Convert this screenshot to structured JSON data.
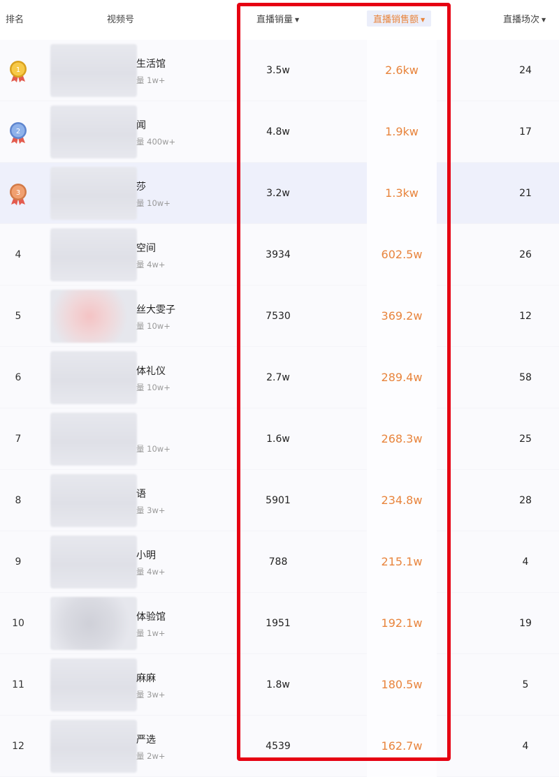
{
  "header": {
    "rank": "排名",
    "channel": "视频号",
    "live_sales": "直播销量",
    "live_gmv": "直播销售额",
    "live_sessions": "直播场次"
  },
  "accent_color": "#e8843c",
  "highlight_color": "#e60012",
  "rows": [
    {
      "rank": "1",
      "medal": "gold",
      "medal_num": "1",
      "name": "生活馆",
      "sub": "量 1w+",
      "sales": "3.5w",
      "gmv": "2.6kw",
      "sessions": "24"
    },
    {
      "rank": "2",
      "medal": "silver",
      "medal_num": "2",
      "name": "闻",
      "sub": "量 400w+",
      "sales": "4.8w",
      "gmv": "1.9kw",
      "sessions": "17"
    },
    {
      "rank": "3",
      "medal": "bronze",
      "medal_num": "3",
      "name": "莎",
      "sub": "量 10w+",
      "sales": "3.2w",
      "gmv": "1.3kw",
      "sessions": "21"
    },
    {
      "rank": "4",
      "name": "空间",
      "sub": "量 4w+",
      "sales": "3934",
      "gmv": "602.5w",
      "sessions": "26"
    },
    {
      "rank": "5",
      "name": "丝大雯子",
      "sub": "量 10w+",
      "sales": "7530",
      "gmv": "369.2w",
      "sessions": "12"
    },
    {
      "rank": "6",
      "name": "体礼仪",
      "sub": "量 10w+",
      "sales": "2.7w",
      "gmv": "289.4w",
      "sessions": "58"
    },
    {
      "rank": "7",
      "name": "",
      "sub": "量 10w+",
      "sales": "1.6w",
      "gmv": "268.3w",
      "sessions": "25"
    },
    {
      "rank": "8",
      "name": "语",
      "sub": "量 3w+",
      "sales": "5901",
      "gmv": "234.8w",
      "sessions": "28"
    },
    {
      "rank": "9",
      "name": "小明",
      "sub": "量 4w+",
      "sales": "788",
      "gmv": "215.1w",
      "sessions": "4"
    },
    {
      "rank": "10",
      "name": "体验馆",
      "sub": "量 1w+",
      "sales": "1951",
      "gmv": "192.1w",
      "sessions": "19"
    },
    {
      "rank": "11",
      "name": "麻麻",
      "sub": "量 3w+",
      "sales": "1.8w",
      "gmv": "180.5w",
      "sessions": "5"
    },
    {
      "rank": "12",
      "name": "严选",
      "sub": "量 2w+",
      "sales": "4539",
      "gmv": "162.7w",
      "sessions": "4"
    }
  ]
}
